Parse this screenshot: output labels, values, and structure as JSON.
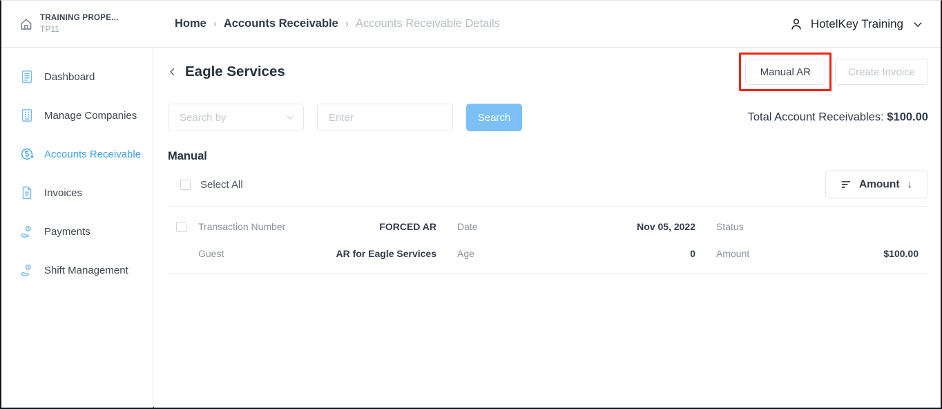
{
  "header": {
    "property_name": "TRAINING PROPE...",
    "property_code": "TP11",
    "home_icon": "home-icon",
    "breadcrumb": [
      {
        "label": "Home",
        "current": false
      },
      {
        "label": "Accounts Receivable",
        "current": false
      },
      {
        "label": "Accounts Receivable Details",
        "current": true
      }
    ],
    "separator": "›",
    "user": {
      "icon": "user-icon",
      "name": "HotelKey Training",
      "chevron": "chevron-down-icon"
    }
  },
  "sidebar": {
    "items": [
      {
        "label": "Dashboard",
        "icon": "dashboard-icon",
        "active": false
      },
      {
        "label": "Manage Companies",
        "icon": "building-icon",
        "active": false
      },
      {
        "label": "Accounts Receivable",
        "icon": "dollar-circle-icon",
        "active": true
      },
      {
        "label": "Invoices",
        "icon": "document-icon",
        "active": false
      },
      {
        "label": "Payments",
        "icon": "hand-coin-icon",
        "active": false
      },
      {
        "label": "Shift Management",
        "icon": "hand-coin-icon",
        "active": false
      }
    ]
  },
  "page": {
    "back_icon": "chevron-left-icon",
    "title": "Eagle Services",
    "actions": {
      "manual_ar": "Manual AR",
      "create_invoice": "Create Invoice"
    },
    "highlight_color": "#f52113"
  },
  "search": {
    "select_placeholder": "Search by",
    "select_chevron": "chevron-down-icon",
    "input_placeholder": "Enter",
    "input_value": "",
    "button_label": "Search",
    "button_color": "#7cc0f7"
  },
  "total": {
    "label": "Total Account Receivables: ",
    "amount": "$100.00"
  },
  "manual": {
    "section_title": "Manual",
    "select_all_label": "Select All",
    "select_all_checked": false,
    "sort": {
      "icon": "sort-icon",
      "label": "Amount",
      "arrow": "↓"
    },
    "rows": [
      {
        "checked": false,
        "fields": [
          {
            "label": "Transaction Number",
            "value": "FORCED AR"
          },
          {
            "label": "Date",
            "value": "Nov 05, 2022"
          },
          {
            "label": "Status",
            "value": ""
          },
          {
            "label": "Guest",
            "value": "AR for Eagle Services"
          },
          {
            "label": "Age",
            "value": "0"
          },
          {
            "label": "Amount",
            "value": "$100.00"
          }
        ]
      }
    ]
  }
}
